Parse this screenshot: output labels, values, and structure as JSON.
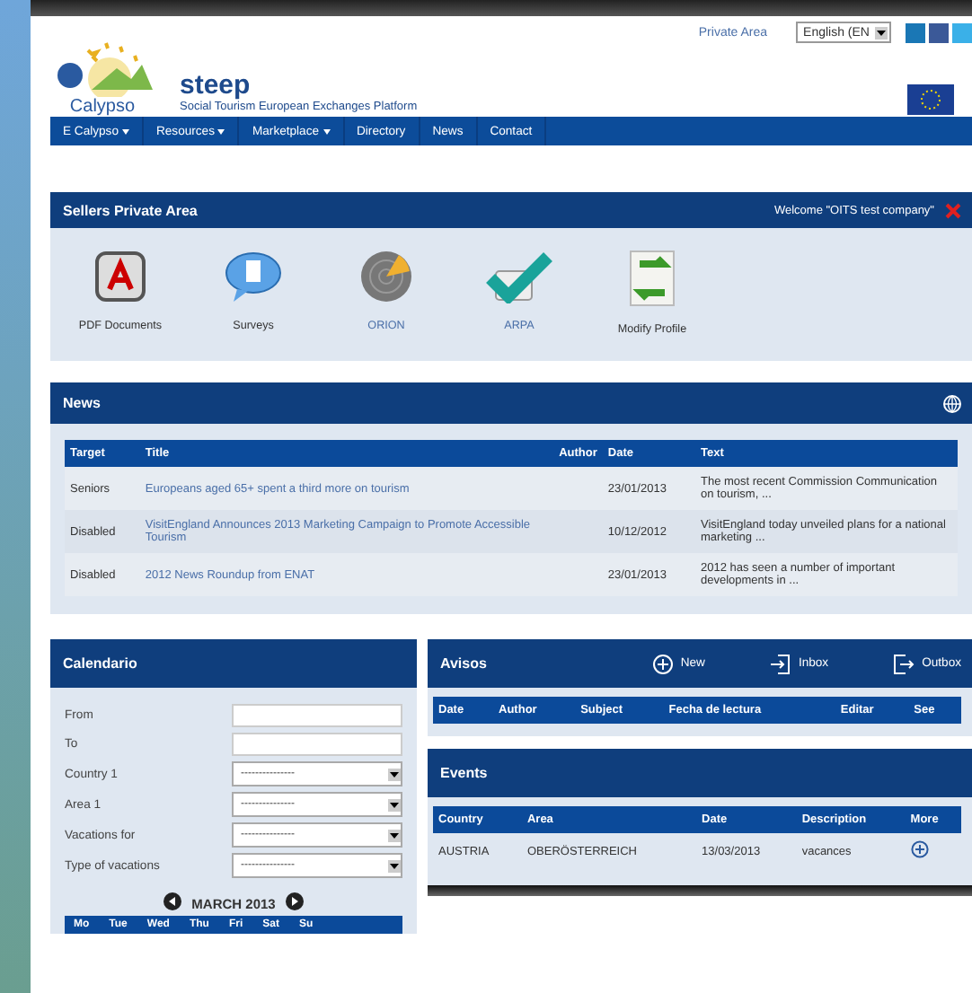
{
  "header": {
    "logo_text": "Calypso",
    "site_title": "steep",
    "subtitle": "Social Tourism European Exchanges Platform",
    "private_area": "Private Area",
    "language": "English (EN"
  },
  "nav": [
    {
      "label": "E Calypso",
      "dropdown": true
    },
    {
      "label": "Resources",
      "dropdown": true
    },
    {
      "label": "Marketplace",
      "dropdown": true
    },
    {
      "label": "Directory",
      "dropdown": false
    },
    {
      "label": "News",
      "dropdown": false
    },
    {
      "label": "Contact",
      "dropdown": false
    }
  ],
  "sellers": {
    "title": "Sellers Private Area",
    "welcome": "Welcome \"OITS test company\"",
    "items": [
      {
        "label": "PDF Documents",
        "kind": "pdf",
        "link": false
      },
      {
        "label": "Surveys",
        "kind": "bubble",
        "link": false
      },
      {
        "label": "ORION",
        "kind": "radar",
        "link": true
      },
      {
        "label": "ARPA",
        "kind": "check",
        "link": true
      },
      {
        "label": "Modify Profile",
        "kind": "refresh",
        "link": false
      }
    ]
  },
  "news": {
    "title": "News",
    "columns": [
      "Target",
      "Title",
      "Author",
      "Date",
      "Text"
    ],
    "rows": [
      {
        "target": "Seniors",
        "title": "Europeans aged 65+ spent a third more on tourism",
        "date": "23/01/2013",
        "text": "The most recent Commission Communication on tourism, ..."
      },
      {
        "target": "Disabled",
        "title": "VisitEngland Announces 2013 Marketing Campaign to Promote Accessible Tourism",
        "date": "10/12/2012",
        "text": "VisitEngland today unveiled plans for a national marketing ..."
      },
      {
        "target": "Disabled",
        "title": "2012 News Roundup from ENAT",
        "date": "23/01/2013",
        "text": "2012 has seen a number of important developments in ..."
      }
    ]
  },
  "calendario": {
    "title": "Calendario",
    "fields": [
      {
        "label": "From",
        "kind": "text"
      },
      {
        "label": "To",
        "kind": "text"
      },
      {
        "label": "Country 1",
        "kind": "select",
        "value": "---------------"
      },
      {
        "label": "Area 1",
        "kind": "select",
        "value": "---------------"
      },
      {
        "label": "Vacations for",
        "kind": "select",
        "value": "---------------"
      },
      {
        "label": "Type of vacations",
        "kind": "select",
        "value": "---------------"
      }
    ],
    "month": "MARCH 2013",
    "days": [
      "Mo",
      "Tue",
      "Wed",
      "Thu",
      "Fri",
      "Sat",
      "Su"
    ]
  },
  "avisos": {
    "title": "Avisos",
    "actions": [
      {
        "label": "New",
        "kind": "new"
      },
      {
        "label": "Inbox",
        "kind": "inbox"
      },
      {
        "label": "Outbox",
        "kind": "outbox"
      }
    ],
    "columns": [
      "Date",
      "Author",
      "Subject",
      "Fecha de lectura",
      "Editar",
      "See"
    ]
  },
  "events": {
    "title": "Events",
    "columns": [
      "Country",
      "Area",
      "Date",
      "Description",
      "More"
    ],
    "rows": [
      {
        "country": "AUSTRIA",
        "area": "OBERÖSTERREICH",
        "date": "13/03/2013",
        "description": "vacances"
      }
    ]
  }
}
